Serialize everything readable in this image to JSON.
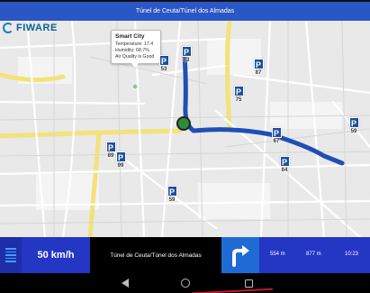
{
  "title_bar": {
    "title": "Túnel de Ceuta/Túnel dos Almadas"
  },
  "map": {
    "logo_text": "FIWARE",
    "route_color": "#1f4fb5",
    "vehicle_color": "#2e8b3a",
    "callout": {
      "title": "Smart City",
      "temperature": "Temperature: 17.4",
      "humidity": "Humidity: 68.7%",
      "air_quality": "Air Quality is Good"
    },
    "parking_markers": [
      {
        "id": "p63",
        "label": "63"
      },
      {
        "id": "p53",
        "label": "53"
      },
      {
        "id": "p87",
        "label": "87"
      },
      {
        "id": "p75",
        "label": "75"
      },
      {
        "id": "p67",
        "label": "67"
      },
      {
        "id": "p59a",
        "label": "59"
      },
      {
        "id": "p89",
        "label": "89"
      },
      {
        "id": "p99",
        "label": "99"
      },
      {
        "id": "p64",
        "label": "64"
      },
      {
        "id": "p59b",
        "label": "59"
      }
    ],
    "parking_icon_letter": "P"
  },
  "nav_panel": {
    "speed": "50 km/h",
    "street": "Túnel de Ceuta/Túnel dos Almadas",
    "distance_next": "554 m",
    "distance_total": "877 m",
    "eta": "10:23",
    "turn_icon": "turn-right-icon"
  },
  "android_nav": {
    "back": "back-icon",
    "home": "home-icon",
    "recent": "recent-apps-icon"
  }
}
